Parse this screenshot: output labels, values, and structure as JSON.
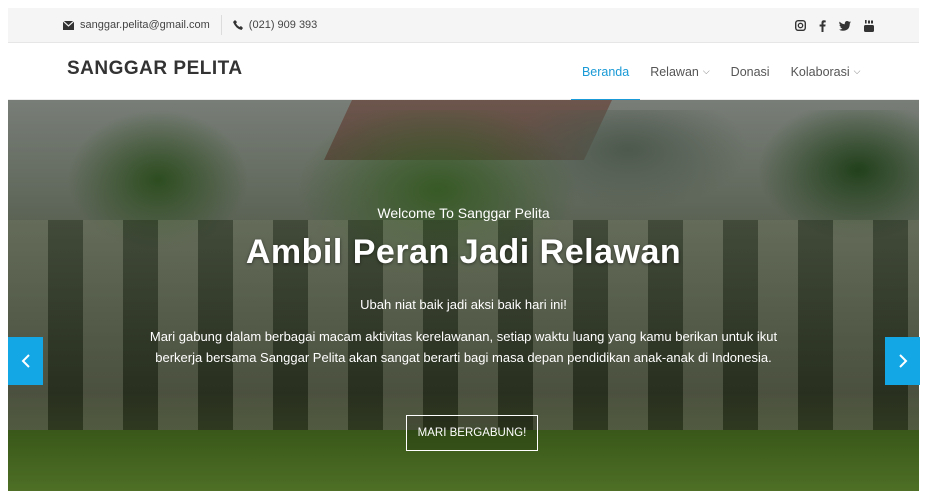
{
  "topbar": {
    "email": "sanggar.pelita@gmail.com",
    "phone": "(021) 909 393",
    "social_icons": [
      "instagram-icon",
      "facebook-icon",
      "twitter-icon",
      "youtube-icon"
    ]
  },
  "navbar": {
    "brand": "SANGGAR PELITA",
    "menu": [
      {
        "label": "Beranda",
        "active": true,
        "dropdown": false
      },
      {
        "label": "Relawan",
        "active": false,
        "dropdown": true
      },
      {
        "label": "Donasi",
        "active": false,
        "dropdown": false
      },
      {
        "label": "Kolaborasi",
        "active": false,
        "dropdown": true
      }
    ]
  },
  "hero": {
    "welcome": "Welcome To Sanggar Pelita",
    "headline": "Ambil Peran Jadi Relawan",
    "tagline": "Ubah niat baik jadi aksi baik hari ini!",
    "description": "Mari gabung dalam berbagai macam aktivitas kerelawanan, setiap waktu luang yang kamu berikan untuk ikut berkerja bersama Sanggar Pelita akan sangat berarti bagi masa depan pendidikan anak-anak di Indonesia.",
    "cta": "MARI BERGABUNG!",
    "prev_icon": "chevron-left-icon",
    "next_icon": "chevron-right-icon"
  },
  "colors": {
    "accent": "#1a9ad6",
    "arrow_bg": "#13a7e6"
  }
}
